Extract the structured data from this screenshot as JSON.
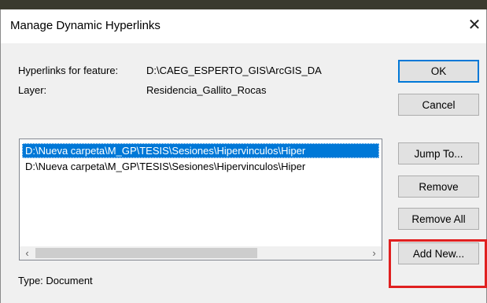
{
  "dialog": {
    "title": "Manage Dynamic Hyperlinks",
    "close_glyph": "✕",
    "feature_label": "Hyperlinks for feature:",
    "feature_value": "D:\\CAEG_ESPERTO_GIS\\ArcGIS_DA",
    "layer_label": "Layer:",
    "layer_value": "Residencia_Gallito_Rocas",
    "hyperlinks": [
      "D:\\Nueva carpeta\\M_GP\\TESIS\\Sesiones\\Hipervinculos\\Hiper",
      "D:\\Nueva carpeta\\M_GP\\TESIS\\Sesiones\\Hipervinculos\\Hiper"
    ],
    "selected_index": 0,
    "type_text": "Type: Document"
  },
  "buttons": {
    "ok": "OK",
    "cancel": "Cancel",
    "jump_to": "Jump To...",
    "remove": "Remove",
    "remove_all": "Remove All",
    "add_new": "Add New..."
  },
  "scrollbar": {
    "left_glyph": "‹",
    "right_glyph": "›"
  },
  "colors": {
    "selection": "#0078d7",
    "annotation_box": "#e02020"
  }
}
